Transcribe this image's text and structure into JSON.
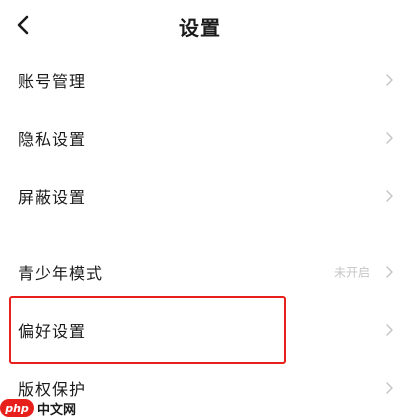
{
  "header": {
    "title": "设置",
    "back_icon": "chevron-left-icon"
  },
  "settings": {
    "items": [
      {
        "label": "账号管理",
        "value": ""
      },
      {
        "label": "隐私设置",
        "value": ""
      },
      {
        "label": "屏蔽设置",
        "value": ""
      },
      {
        "label": "青少年模式",
        "value": "未开启"
      },
      {
        "label": "偏好设置",
        "value": ""
      },
      {
        "label": "版权保护",
        "value": ""
      }
    ]
  },
  "annotation": {
    "highlight_color": "#e8201b",
    "highlighted_item": "偏好设置"
  },
  "watermark": {
    "logo": "php",
    "text": "中文网"
  },
  "colors": {
    "text": "#1a1a1a",
    "muted": "#c6c6c6",
    "accent": "#e8201b"
  }
}
